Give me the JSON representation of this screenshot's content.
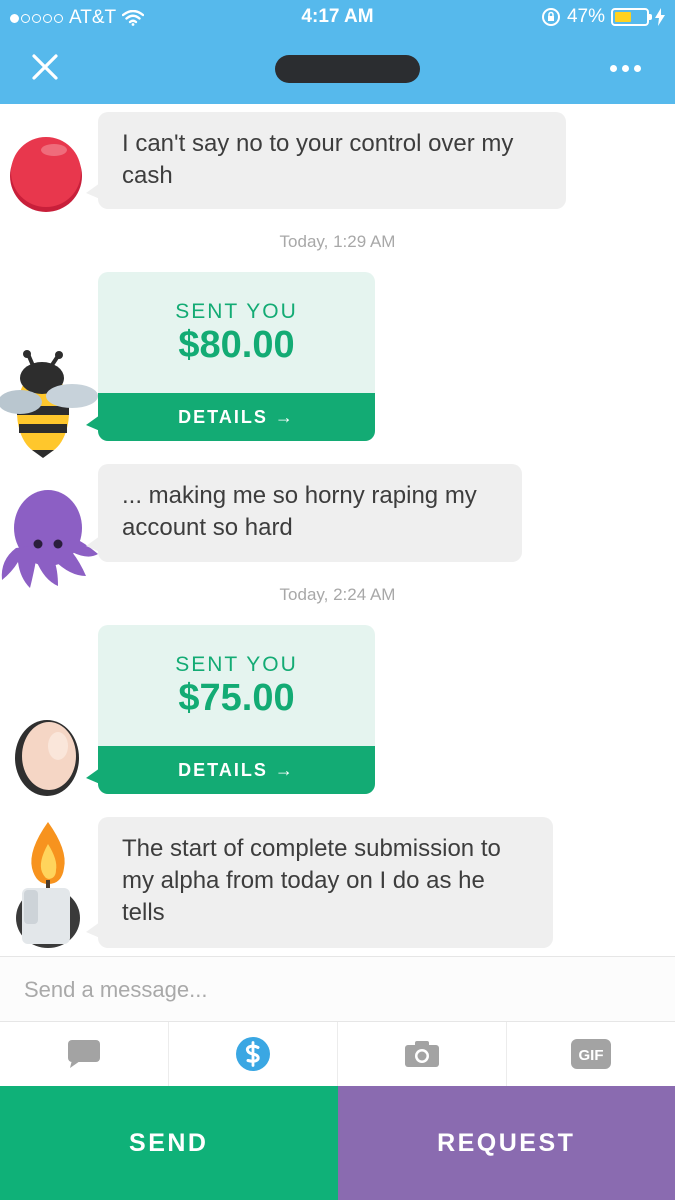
{
  "status_bar": {
    "carrier": "AT&T",
    "time": "4:17 AM",
    "battery": "47%",
    "battery_level": 0.47,
    "signal_bars_filled": 1,
    "signal_bars_total": 5
  },
  "nav": {
    "close_icon": "close-icon",
    "more_icon": "more-dots-icon"
  },
  "messages": [
    {
      "type": "text",
      "text": "I can't say no to your control over my cash"
    },
    {
      "type": "timestamp",
      "text": "Today, 1:29 AM"
    },
    {
      "type": "payment",
      "label": "SENT YOU",
      "amount": "$80.00",
      "details": "DETAILS →"
    },
    {
      "type": "text",
      "text": "... making me so horny raping my account so hard"
    },
    {
      "type": "timestamp",
      "text": "Today, 2:24 AM"
    },
    {
      "type": "payment",
      "label": "SENT YOU",
      "amount": "$75.00",
      "details": "DETAILS →"
    },
    {
      "type": "text",
      "text": "The start of complete submission to my alpha from today on I do as he tells"
    }
  ],
  "composer": {
    "placeholder": "Send a message..."
  },
  "toolbar": {
    "tabs": [
      {
        "icon": "chat-bubble-icon"
      },
      {
        "icon": "dollar-icon",
        "active": true
      },
      {
        "icon": "camera-icon"
      },
      {
        "icon": "gif-icon",
        "label": "GIF"
      }
    ]
  },
  "actions": {
    "send": "SEND",
    "request": "REQUEST"
  },
  "colors": {
    "header": "#56b9ec",
    "payment_green": "#13ab74",
    "send_green": "#0fb178",
    "request_purple": "#8a6bb0",
    "bubble_gray": "#efefef"
  }
}
